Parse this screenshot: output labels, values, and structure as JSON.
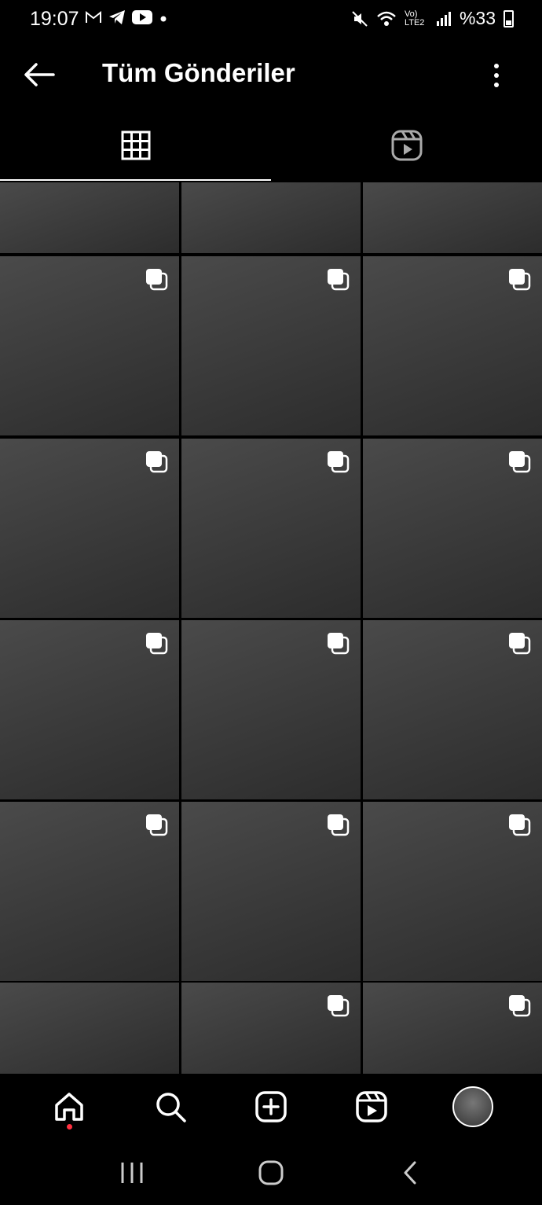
{
  "status_bar": {
    "time": "19:07",
    "battery": "%33",
    "network": "Vo) LTE2",
    "left_icons": [
      "gmail-icon",
      "telegram-icon",
      "youtube-icon",
      "dot-icon"
    ],
    "right_icons": [
      "mute-icon",
      "wifi-icon",
      "signal-icon",
      "battery-icon"
    ]
  },
  "header": {
    "title": "Tüm Gönderiler",
    "back_icon": "arrow-left-icon",
    "more_icon": "more-vertical-icon"
  },
  "tabs": [
    {
      "icon": "grid-icon",
      "active": true
    },
    {
      "icon": "reels-icon",
      "active": false
    }
  ],
  "grid": {
    "columns": 3,
    "note": "thumbnails not reproduced",
    "multi_photo_badge": "carousel-icon"
  },
  "bottom_nav": [
    {
      "icon": "home-icon",
      "active": true,
      "notification": true
    },
    {
      "icon": "search-icon"
    },
    {
      "icon": "create-icon"
    },
    {
      "icon": "reels-icon"
    },
    {
      "icon": "profile-avatar"
    }
  ],
  "system_nav": [
    "recents-icon",
    "home-pill-icon",
    "back-icon"
  ]
}
